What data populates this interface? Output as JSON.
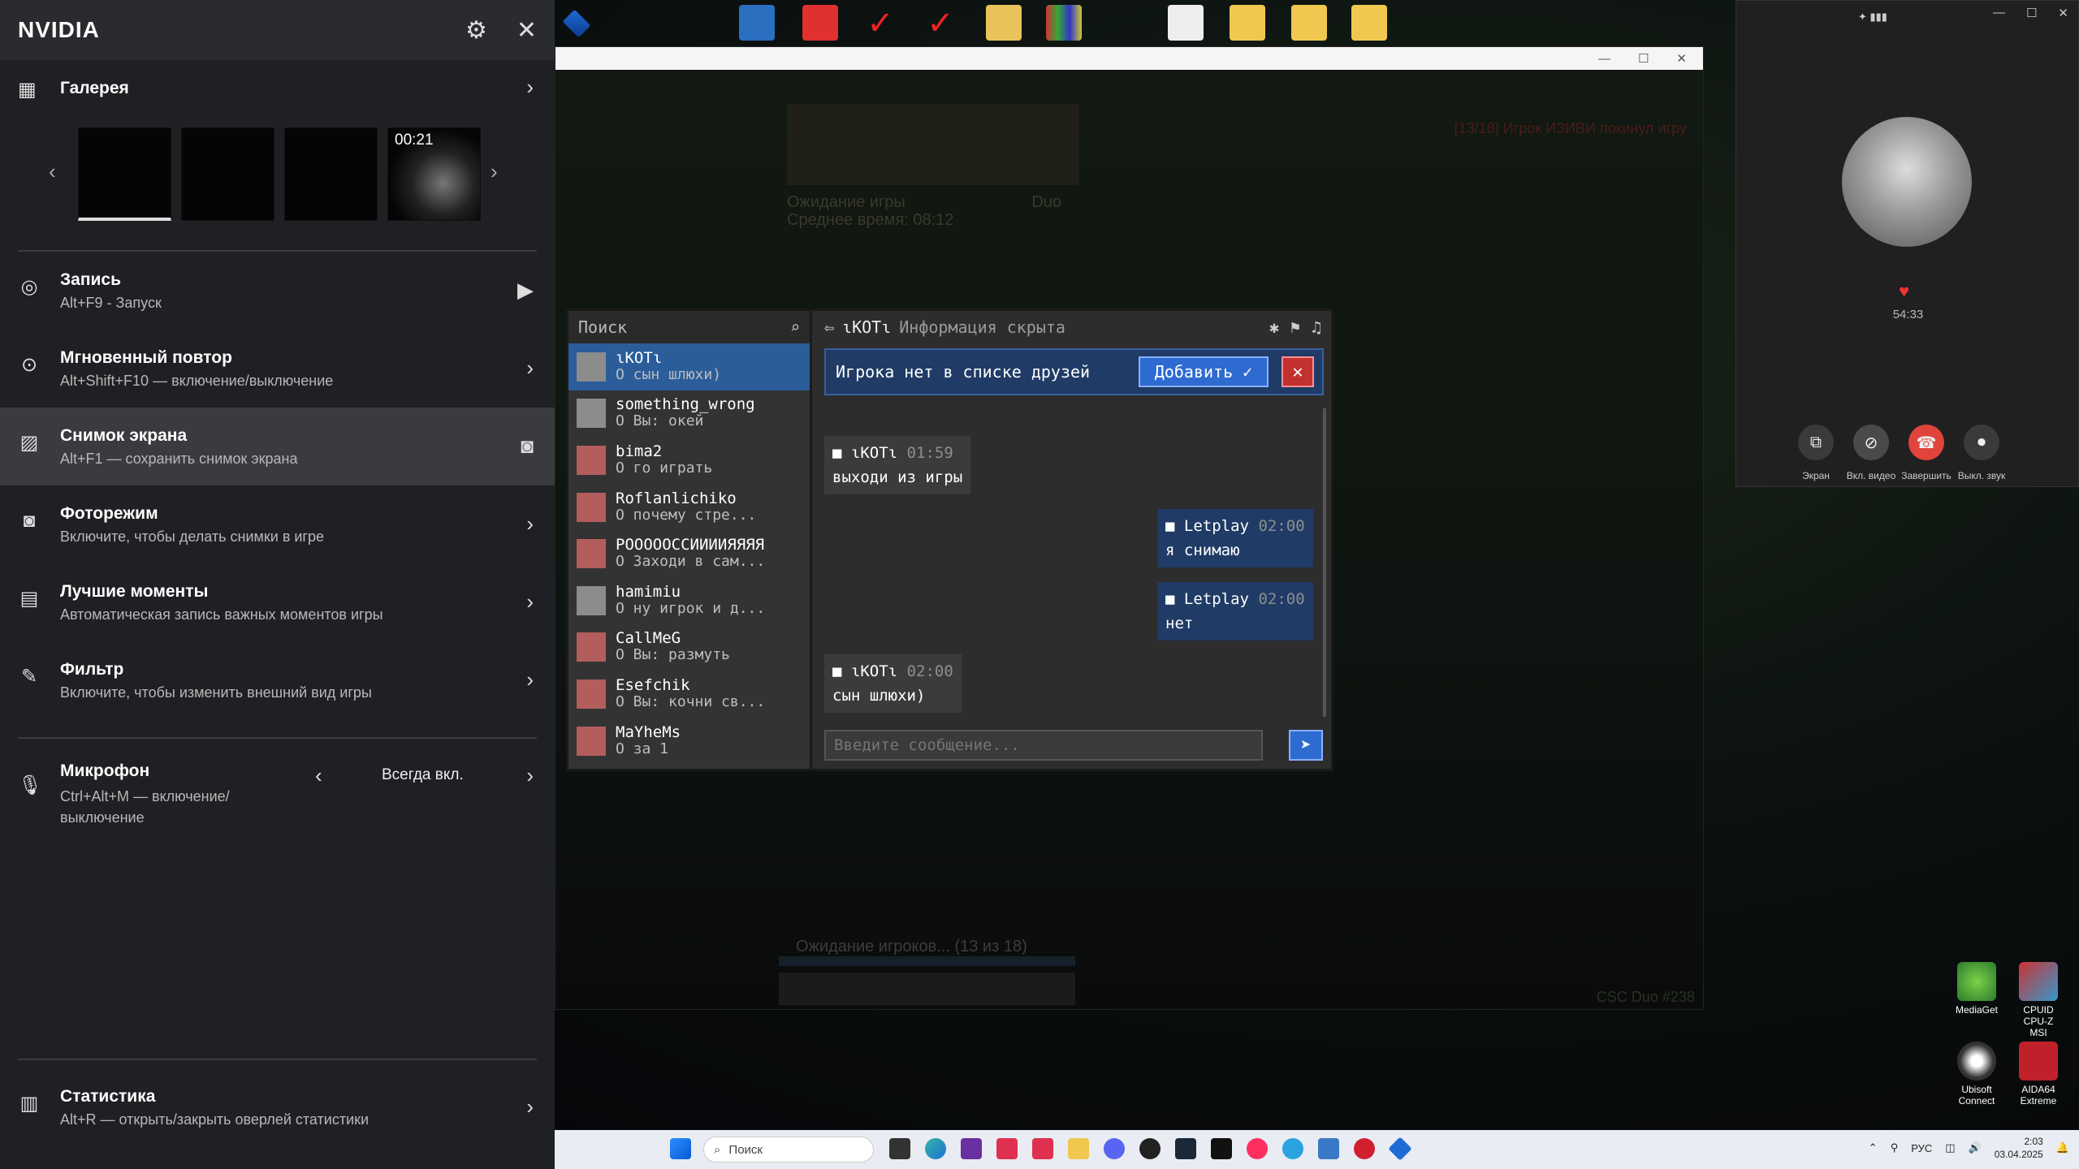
{
  "nvidia": {
    "title": "NVIDIA",
    "gallery": {
      "label": "Галерея",
      "thumb_duration": "00:21"
    },
    "items": [
      {
        "label": "Запись",
        "sub": "Alt+F9 - Запуск"
      },
      {
        "label": "Мгновенный повтор",
        "sub": "Alt+Shift+F10 — включение/выключение"
      },
      {
        "label": "Снимок экрана",
        "sub": "Alt+F1 — сохранить снимок экрана"
      },
      {
        "label": "Фоторежим",
        "sub": "Включите, чтобы делать снимки в игре"
      },
      {
        "label": "Лучшие моменты",
        "sub": "Автоматическая запись важных моментов игры"
      },
      {
        "label": "Фильтр",
        "sub": "Включите, чтобы изменить внешний вид игры"
      }
    ],
    "mic": {
      "label": "Микрофон",
      "sub": "Ctrl+Alt+M — включение/\nвыключение",
      "value": "Всегда вкл."
    },
    "stats": {
      "label": "Статистика",
      "sub": "Alt+R — открыть/закрыть оверлей статистики"
    }
  },
  "game": {
    "queue_line1": "Ожидание игры",
    "queue_mode": "Duo",
    "queue_line2": "Среднее время: 08:12",
    "notice": "[13/18] Игрок ИЗИВИ покинул игру",
    "waiting": "Ожидание игроков... (13 из 18)",
    "code": "CSC Duo #238"
  },
  "chat": {
    "search_placeholder": "Поиск",
    "contacts": [
      {
        "name": "ɩKOTɩ",
        "msg": "О сын шлюхи)"
      },
      {
        "name": "something_wrong",
        "msg": "О Вы: окей"
      },
      {
        "name": "bima2",
        "msg": "О го играть"
      },
      {
        "name": "Roflanlichiko",
        "msg": "О почему стре..."
      },
      {
        "name": "PОООООССИИИИЯЯЯЯ",
        "msg": "О Заходи в сам..."
      },
      {
        "name": "hamimiu",
        "msg": "О ну игрок и д..."
      },
      {
        "name": "CallMeG",
        "msg": "О Вы: размуть"
      },
      {
        "name": "Esefchik",
        "msg": "О Вы: кочни св..."
      },
      {
        "name": "MaYheMs",
        "msg": "О за 1"
      }
    ],
    "header_name": "ɩKOTɩ",
    "header_info": "Информация скрыта",
    "friend_notice": "Игрока нет в списке друзей",
    "add_label": "Добавить ✓",
    "messages": [
      {
        "name": "ɩKOTɩ",
        "time": "01:59",
        "text": "выходи из игры"
      },
      {
        "name": "Letplay",
        "time": "02:00",
        "text": "я снимаю"
      },
      {
        "name": "Letplay",
        "time": "02:00",
        "text": "нет"
      },
      {
        "name": "ɩKOTɩ",
        "time": "02:00",
        "text": "сын шлюхи)"
      }
    ],
    "input_placeholder": "Введите сообщение..."
  },
  "call": {
    "timer": "54:33",
    "buttons": [
      "Экран",
      "Вкл. видео",
      "Завершить",
      "Выкл. звук"
    ]
  },
  "desktop": {
    "icons": [
      {
        "label": "MediaGet"
      },
      {
        "label": "CPUID CPU-Z MSI"
      },
      {
        "label": "Ubisoft Connect"
      },
      {
        "label": "AIDA64 Extreme"
      }
    ]
  },
  "taskbar": {
    "search_placeholder": "Поиск",
    "lang": "РУС",
    "time": "2:03",
    "date": "03.04.2025"
  }
}
